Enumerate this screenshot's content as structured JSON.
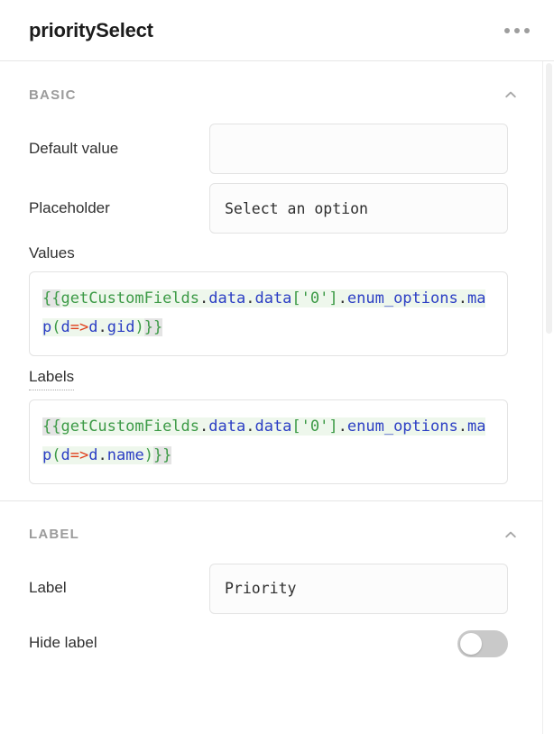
{
  "header": {
    "title": "prioritySelect",
    "menu_icon": "kebab-menu-icon"
  },
  "scroll": {
    "has_scrollbar": true
  },
  "sections": [
    {
      "id": "basic",
      "title": "BASIC",
      "collapse_icon": "chevron-up-icon",
      "fields": {
        "default_value": {
          "label": "Default value",
          "value": "",
          "placeholder": ""
        },
        "placeholder": {
          "label": "Placeholder",
          "value": "Select an option",
          "placeholder": ""
        },
        "values": {
          "label": "Values",
          "has_hint_underline": false,
          "code": "{{getCustomFields.data.data['0'].enum_options.map(d=>d.gid)}}"
        },
        "labels": {
          "label": "Labels",
          "has_hint_underline": true,
          "code": "{{getCustomFields.data.data['0'].enum_options.map(d=>d.name)}}"
        }
      }
    },
    {
      "id": "label",
      "title": "LABEL",
      "collapse_icon": "chevron-up-icon",
      "fields": {
        "label": {
          "label": "Label",
          "value": "Priority",
          "placeholder": ""
        },
        "hide_label": {
          "label": "Hide label",
          "toggle_state": "off"
        }
      }
    }
  ],
  "colors": {
    "text": "#212121",
    "section_title": "#9b9b9b",
    "border": "#e3e3e3",
    "code_bg": "#eef7ec",
    "code_green": "#3c9a46",
    "code_blue": "#2b3ec4",
    "code_red": "#e03e1a",
    "toggle_off": "#c9c9c9"
  }
}
